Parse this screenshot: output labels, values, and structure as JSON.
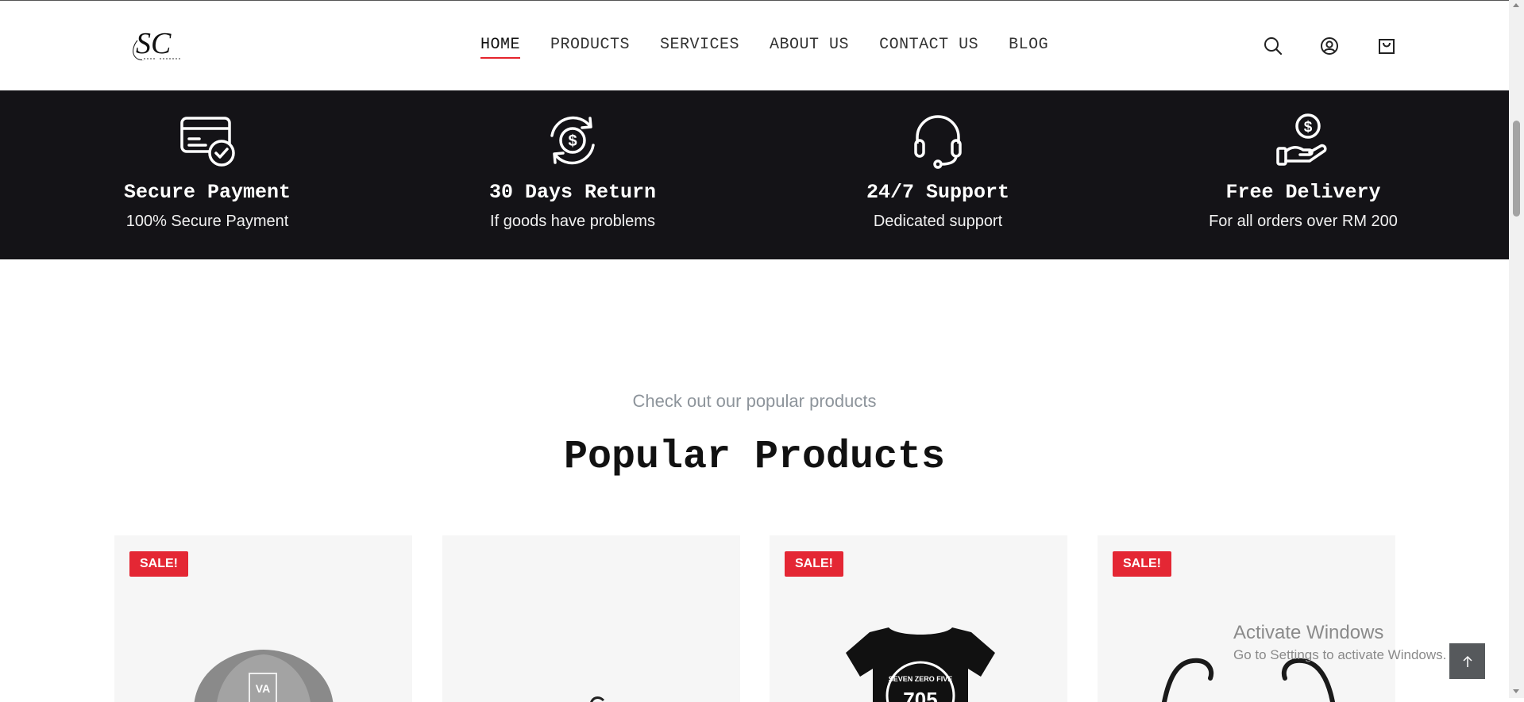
{
  "header": {
    "logo": {
      "text": "SC",
      "tagline": "SOUL COUTURE"
    },
    "nav": [
      {
        "label": "HOME",
        "active": true
      },
      {
        "label": "PRODUCTS",
        "active": false
      },
      {
        "label": "SERVICES",
        "active": false
      },
      {
        "label": "ABOUT US",
        "active": false
      },
      {
        "label": "CONTACT US",
        "active": false
      },
      {
        "label": "BLOG",
        "active": false
      }
    ],
    "icons": [
      "search-icon",
      "user-icon",
      "cart-icon"
    ]
  },
  "features": [
    {
      "icon": "credit-card-check-icon",
      "title": "Secure Payment",
      "subtitle": "100% Secure Payment"
    },
    {
      "icon": "money-return-icon",
      "title": "30 Days Return",
      "subtitle": "If goods have problems"
    },
    {
      "icon": "headset-icon",
      "title": "24/7 Support",
      "subtitle": "Dedicated support"
    },
    {
      "icon": "hand-coin-icon",
      "title": "Free Delivery",
      "subtitle": "For all orders over RM 200"
    }
  ],
  "popular": {
    "subtitle": "Check out our popular products",
    "title": "Popular Products",
    "products": [
      {
        "badge": "SALE!",
        "image": "cap-image",
        "logo_text": "VA"
      },
      {
        "badge": "",
        "image": "product-image"
      },
      {
        "badge": "SALE!",
        "image": "tshirt-image",
        "print_text": "SEVEN ZERO FIVE",
        "print_number": "705"
      },
      {
        "badge": "SALE!",
        "image": "sunglasses-image"
      }
    ]
  },
  "overlay": {
    "windows_title": "Activate Windows",
    "windows_sub": "Go to Settings to activate Windows."
  },
  "colors": {
    "accent": "#e5242c",
    "sale_badge": "#e42734",
    "band": "#141317",
    "card_bg": "#f6f6f6",
    "muted_text": "#8d949b"
  }
}
